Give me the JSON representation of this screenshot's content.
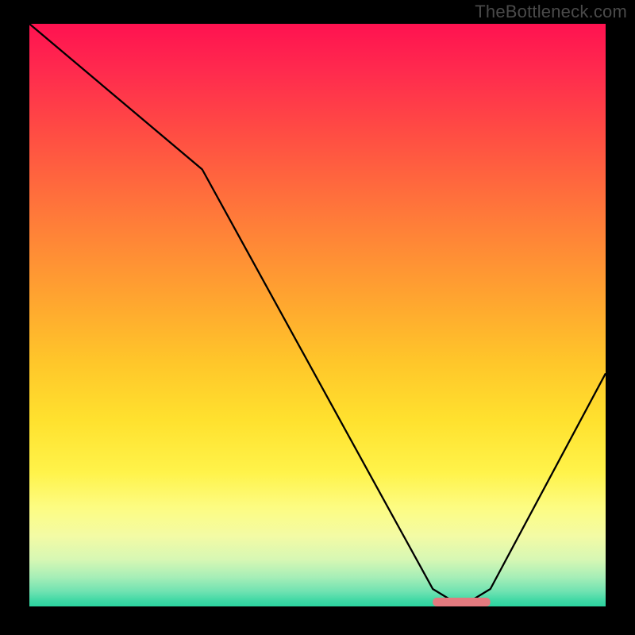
{
  "watermark": "TheBottleneck.com",
  "chart_data": {
    "type": "line",
    "title": "",
    "xlabel": "",
    "ylabel": "",
    "xlim": [
      0,
      100
    ],
    "ylim": [
      0,
      100
    ],
    "grid": false,
    "legend": false,
    "annotations": [],
    "background": {
      "type": "vertical-gradient",
      "stops": [
        {
          "pos": 0.0,
          "color": "#ff1250"
        },
        {
          "pos": 0.5,
          "color": "#ffc62a"
        },
        {
          "pos": 0.85,
          "color": "#fdfc82"
        },
        {
          "pos": 1.0,
          "color": "#2bd39f"
        }
      ]
    },
    "series": [
      {
        "name": "bottleneck-curve",
        "color": "#000000",
        "x": [
          0,
          30,
          70,
          75,
          80,
          100
        ],
        "y": [
          100,
          75,
          3,
          0,
          3,
          40
        ]
      }
    ],
    "marker": {
      "shape": "rounded-bar",
      "color": "#e37a7f",
      "x_range": [
        70,
        80
      ],
      "y": 0
    }
  }
}
